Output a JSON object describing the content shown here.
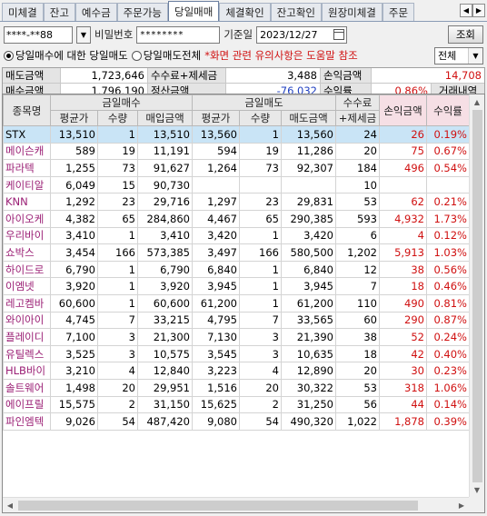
{
  "tabs": [
    "미체결",
    "잔고",
    "예수금",
    "주문가능",
    "당일매매",
    "체결확인",
    "잔고확인",
    "원장미체결",
    "주문"
  ],
  "active_tab": "당일매매",
  "account": {
    "value": "****-**88"
  },
  "password": {
    "label": "비밀번호",
    "value": "********"
  },
  "base_date": {
    "label": "기준일",
    "value": "2023/12/27"
  },
  "query_button": "조회",
  "radios": [
    {
      "label": "당일매수에 대한 당일매도",
      "selected": true
    },
    {
      "label": "당일매도전체",
      "selected": false
    }
  ],
  "notice": "*화면 관련 유의사항은 도움말 참조",
  "filter_select": "전체",
  "summary": {
    "sell_amount_label": "매도금액",
    "sell_amount": "1,723,646",
    "fee_tax_label": "수수료+제세금",
    "fee_tax": "3,488",
    "pnl_amount_label": "손익금액",
    "pnl_amount": "14,708",
    "buy_amount_label": "매수금액",
    "buy_amount": "1,796,190",
    "settle_amount_label": "정산금액",
    "settle_amount": "-76,032",
    "return_rate_label": "수익률",
    "return_rate": "0.86%",
    "history_label": "거래내역"
  },
  "table": {
    "headers": {
      "name": "종목명",
      "buy_group": "금일매수",
      "sell_group": "금일매도",
      "fee": "수수료",
      "fee2": "+제세금",
      "pnl": "손익금액",
      "rate": "수익률",
      "avg": "평균가",
      "qty": "수량",
      "buy_amt": "매입금액",
      "sell_amt": "매도금액"
    },
    "rows": [
      {
        "name": "STX",
        "bavg": "13,510",
        "bqty": "1",
        "bamt": "13,510",
        "savg": "13,560",
        "sqty": "1",
        "samt": "13,560",
        "fee": "24",
        "pnl": "26",
        "rate": "0.19%"
      },
      {
        "name": "메이슨캐",
        "bavg": "589",
        "bqty": "19",
        "bamt": "11,191",
        "savg": "594",
        "sqty": "19",
        "samt": "11,286",
        "fee": "20",
        "pnl": "75",
        "rate": "0.67%"
      },
      {
        "name": "파라텍",
        "bavg": "1,255",
        "bqty": "73",
        "bamt": "91,627",
        "savg": "1,264",
        "sqty": "73",
        "samt": "92,307",
        "fee": "184",
        "pnl": "496",
        "rate": "0.54%"
      },
      {
        "name": "케이티알",
        "bavg": "6,049",
        "bqty": "15",
        "bamt": "90,730",
        "savg": "",
        "sqty": "",
        "samt": "",
        "fee": "10",
        "pnl": "",
        "rate": ""
      },
      {
        "name": "KNN",
        "bavg": "1,292",
        "bqty": "23",
        "bamt": "29,716",
        "savg": "1,297",
        "sqty": "23",
        "samt": "29,831",
        "fee": "53",
        "pnl": "62",
        "rate": "0.21%"
      },
      {
        "name": "아이오케",
        "bavg": "4,382",
        "bqty": "65",
        "bamt": "284,860",
        "savg": "4,467",
        "sqty": "65",
        "samt": "290,385",
        "fee": "593",
        "pnl": "4,932",
        "rate": "1.73%"
      },
      {
        "name": "우리바이",
        "bavg": "3,410",
        "bqty": "1",
        "bamt": "3,410",
        "savg": "3,420",
        "sqty": "1",
        "samt": "3,420",
        "fee": "6",
        "pnl": "4",
        "rate": "0.12%"
      },
      {
        "name": "쇼박스",
        "bavg": "3,454",
        "bqty": "166",
        "bamt": "573,385",
        "savg": "3,497",
        "sqty": "166",
        "samt": "580,500",
        "fee": "1,202",
        "pnl": "5,913",
        "rate": "1.03%"
      },
      {
        "name": "하이드로",
        "bavg": "6,790",
        "bqty": "1",
        "bamt": "6,790",
        "savg": "6,840",
        "sqty": "1",
        "samt": "6,840",
        "fee": "12",
        "pnl": "38",
        "rate": "0.56%"
      },
      {
        "name": "이엠넷",
        "bavg": "3,920",
        "bqty": "1",
        "bamt": "3,920",
        "savg": "3,945",
        "sqty": "1",
        "samt": "3,945",
        "fee": "7",
        "pnl": "18",
        "rate": "0.46%"
      },
      {
        "name": "레고켐바",
        "bavg": "60,600",
        "bqty": "1",
        "bamt": "60,600",
        "savg": "61,200",
        "sqty": "1",
        "samt": "61,200",
        "fee": "110",
        "pnl": "490",
        "rate": "0.81%"
      },
      {
        "name": "와이아이",
        "bavg": "4,745",
        "bqty": "7",
        "bamt": "33,215",
        "savg": "4,795",
        "sqty": "7",
        "samt": "33,565",
        "fee": "60",
        "pnl": "290",
        "rate": "0.87%"
      },
      {
        "name": "플레이디",
        "bavg": "7,100",
        "bqty": "3",
        "bamt": "21,300",
        "savg": "7,130",
        "sqty": "3",
        "samt": "21,390",
        "fee": "38",
        "pnl": "52",
        "rate": "0.24%"
      },
      {
        "name": "유틸렉스",
        "bavg": "3,525",
        "bqty": "3",
        "bamt": "10,575",
        "savg": "3,545",
        "sqty": "3",
        "samt": "10,635",
        "fee": "18",
        "pnl": "42",
        "rate": "0.40%"
      },
      {
        "name": "HLB바이",
        "bavg": "3,210",
        "bqty": "4",
        "bamt": "12,840",
        "savg": "3,223",
        "sqty": "4",
        "samt": "12,890",
        "fee": "20",
        "pnl": "30",
        "rate": "0.23%"
      },
      {
        "name": "솔트웨어",
        "bavg": "1,498",
        "bqty": "20",
        "bamt": "29,951",
        "savg": "1,516",
        "sqty": "20",
        "samt": "30,322",
        "fee": "53",
        "pnl": "318",
        "rate": "1.06%"
      },
      {
        "name": "에이프릴",
        "bavg": "15,575",
        "bqty": "2",
        "bamt": "31,150",
        "savg": "15,625",
        "sqty": "2",
        "samt": "31,250",
        "fee": "56",
        "pnl": "44",
        "rate": "0.14%"
      },
      {
        "name": "파인엠텍",
        "bavg": "9,026",
        "bqty": "54",
        "bamt": "487,420",
        "savg": "9,080",
        "sqty": "54",
        "samt": "490,320",
        "fee": "1,022",
        "pnl": "1,878",
        "rate": "0.39%"
      }
    ]
  },
  "colors": {
    "loss_blue": "#1f3fc0",
    "profit_red": "#d01010",
    "selected_row": "#c9e4f6",
    "name_purple": "#9a1e74"
  }
}
